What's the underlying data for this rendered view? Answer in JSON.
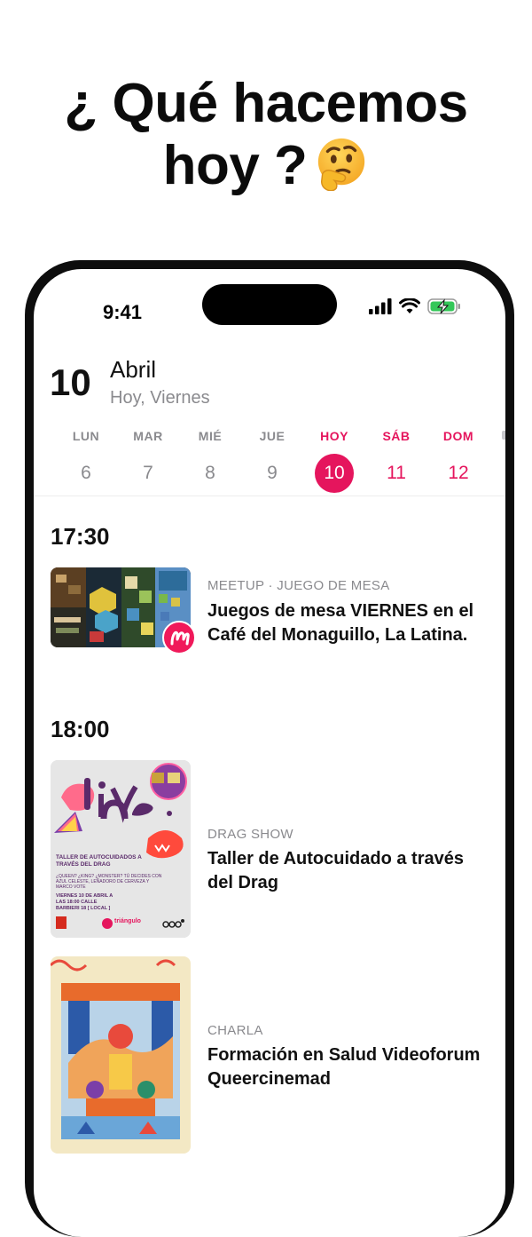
{
  "headline": {
    "line1": "¿ Qué hacemos",
    "line2": "hoy ?"
  },
  "status_bar": {
    "time": "9:41"
  },
  "header": {
    "day_number": "10",
    "month": "Abril",
    "subtitle": "Hoy, Viernes"
  },
  "week": [
    {
      "name": "LUN",
      "date": "6",
      "state": "normal"
    },
    {
      "name": "MAR",
      "date": "7",
      "state": "normal"
    },
    {
      "name": "MIÉ",
      "date": "8",
      "state": "normal"
    },
    {
      "name": "JUE",
      "date": "9",
      "state": "normal"
    },
    {
      "name": "HOY",
      "date": "10",
      "state": "today"
    },
    {
      "name": "SÁB",
      "date": "11",
      "state": "weekend"
    },
    {
      "name": "DOM",
      "date": "12",
      "state": "weekend"
    }
  ],
  "sections": [
    {
      "time": "17:30",
      "events": [
        {
          "category": "MEETUP · JUEGO DE MESA",
          "title": "Juegos de mesa VIERNES en el Café del Monaguillo, La Latina.",
          "image": "board-games-photo"
        }
      ]
    },
    {
      "time": "18:00",
      "events": [
        {
          "category": "DRAG SHOW",
          "title": "Taller de Autocuidado a través del Drag",
          "image": "drag-poster"
        },
        {
          "category": "CHARLA",
          "title": "Formación en Salud Videoforum Queercinemad",
          "image": "illustration-poster"
        }
      ]
    }
  ],
  "poster": {
    "brand": "Divine",
    "heading": "TALLER DE AUTOCUIDADOS A TRAVÉS DEL DRAG",
    "lines": [
      "¿QUEEN? ¿KING? ¿MONSTER? TÚ DECIDES CON",
      "AZUL CELESTE, LEÑADORO DE CERVEZA Y",
      "MARCO VOTE"
    ],
    "date_lines": [
      "VIERNES 10 DE ABRIL A",
      "LAS 18:00 CALLE",
      "BARBIERI 18 [ LOCAL ]"
    ],
    "logo_label": "triángulo"
  },
  "colors": {
    "accent": "#e5155d",
    "muted": "#8a8a8e",
    "meetup": "#f0195a"
  }
}
